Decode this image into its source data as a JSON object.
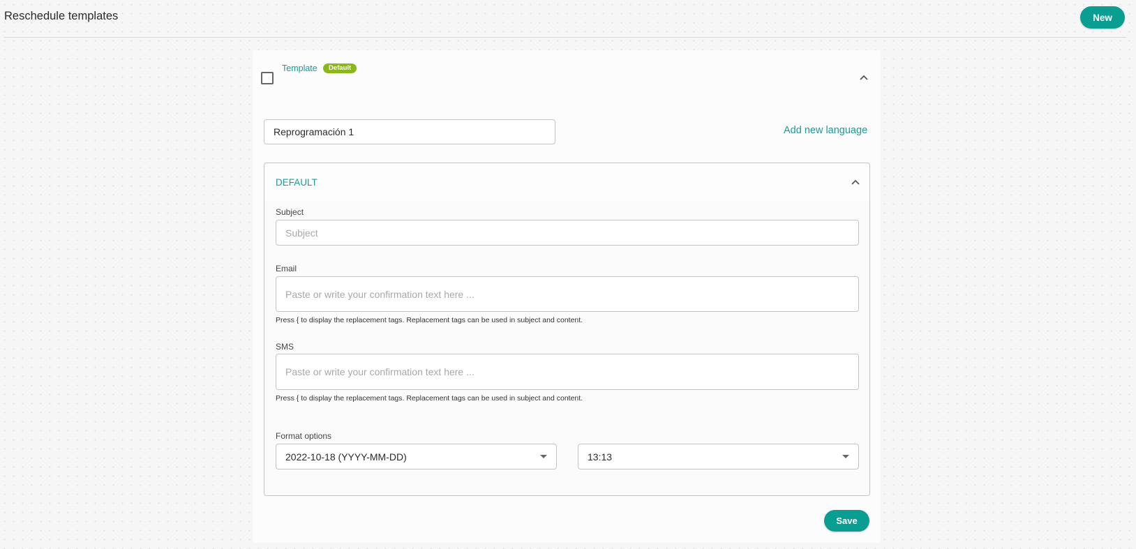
{
  "header": {
    "title": "Reschedule templates",
    "new_label": "New"
  },
  "template": {
    "label": "Template",
    "badge": "Default",
    "name_value": "Reprogramación 1",
    "add_language_label": "Add new language",
    "language": {
      "title": "DEFAULT",
      "subject": {
        "label": "Subject",
        "placeholder": "Subject",
        "value": ""
      },
      "email": {
        "label": "Email",
        "placeholder": "Paste or write your confirmation text here ...",
        "value": "",
        "hint": "Press { to display the replacement tags. Replacement tags can be used in subject and content."
      },
      "sms": {
        "label": "SMS",
        "placeholder": "Paste or write your confirmation text here ...",
        "value": "",
        "hint": "Press { to display the replacement tags. Replacement tags can be used in subject and content."
      },
      "format": {
        "label": "Format options",
        "date_value": "2022-10-18 (YYYY-MM-DD)",
        "time_value": "13:13"
      }
    },
    "save_label": "Save"
  },
  "colors": {
    "accent": "#0a9e92",
    "badge": "#8ab81c",
    "link": "#1a9a96"
  }
}
